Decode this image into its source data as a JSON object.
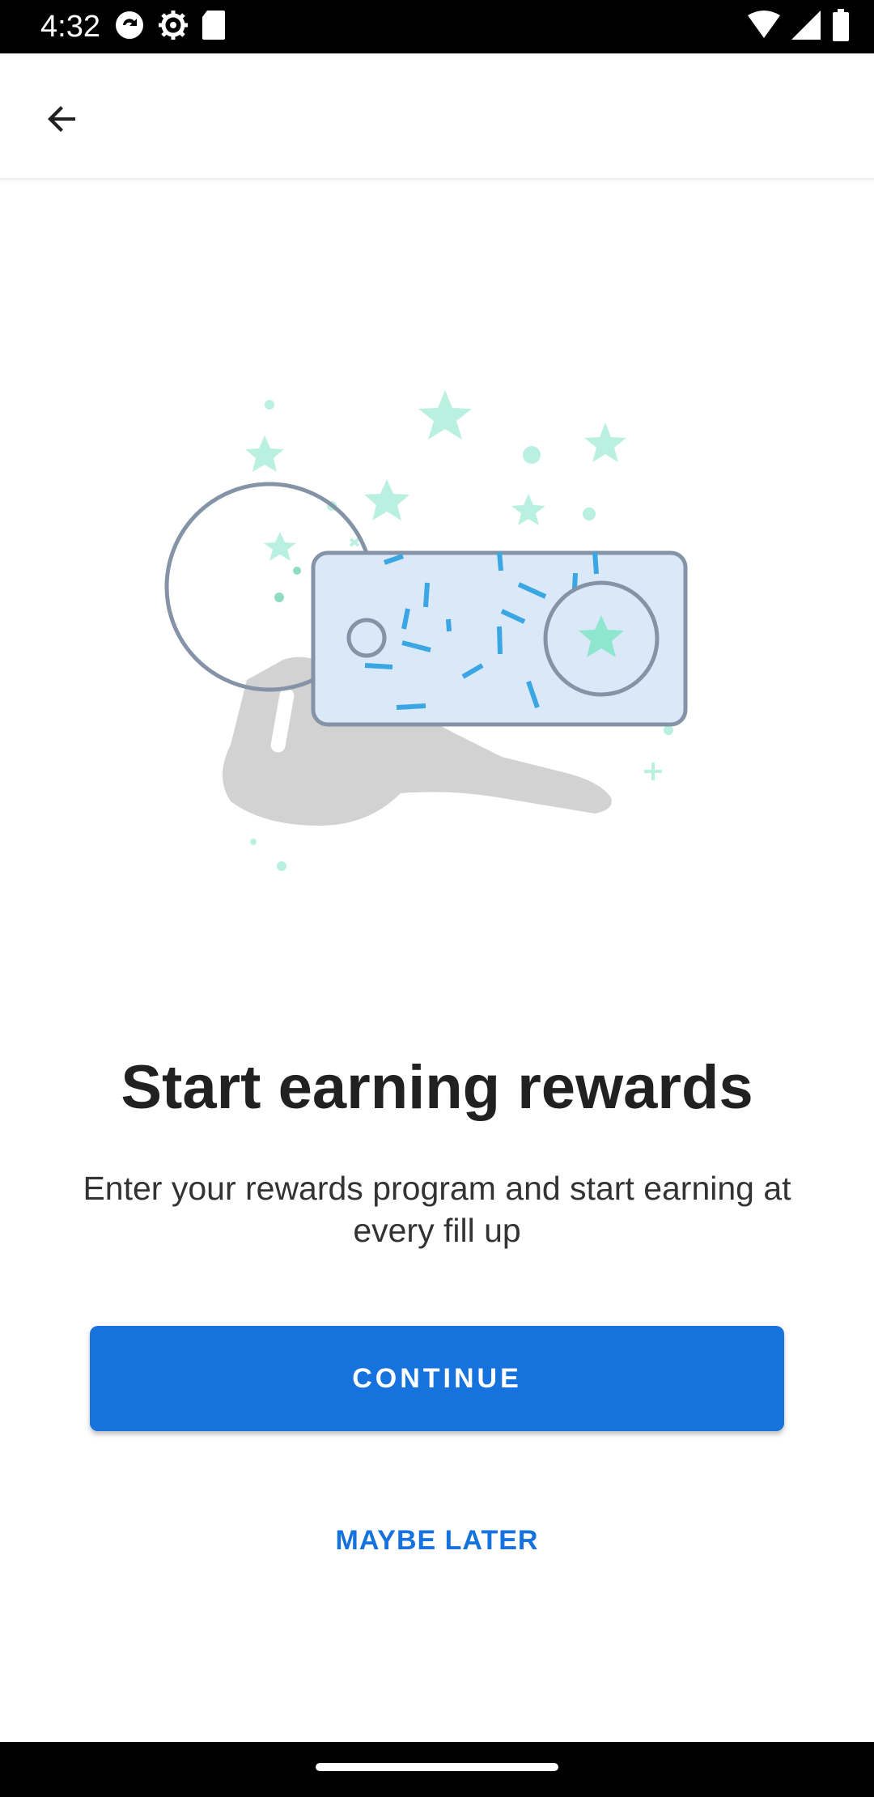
{
  "status_bar": {
    "time": "4:32",
    "left_icons": [
      "sync-icon",
      "settings-icon",
      "sd-card-icon"
    ],
    "right_icons": [
      "wifi-icon",
      "signal-icon",
      "battery-icon"
    ]
  },
  "app_bar": {
    "back_icon": "arrow-back-icon"
  },
  "content": {
    "title": "Start earning rewards",
    "subtitle": "Enter your rewards program and start earning at every fill up",
    "continue_label": "CONTINUE",
    "maybe_later_label": "MAYBE LATER"
  },
  "colors": {
    "primary": "#1672dc",
    "accent_mint": "#b9f0df",
    "card_fill": "#dbe8f8",
    "card_stroke": "#8593a6",
    "confetti": "#3aa6e3",
    "key_gray": "#d2d2d2"
  }
}
